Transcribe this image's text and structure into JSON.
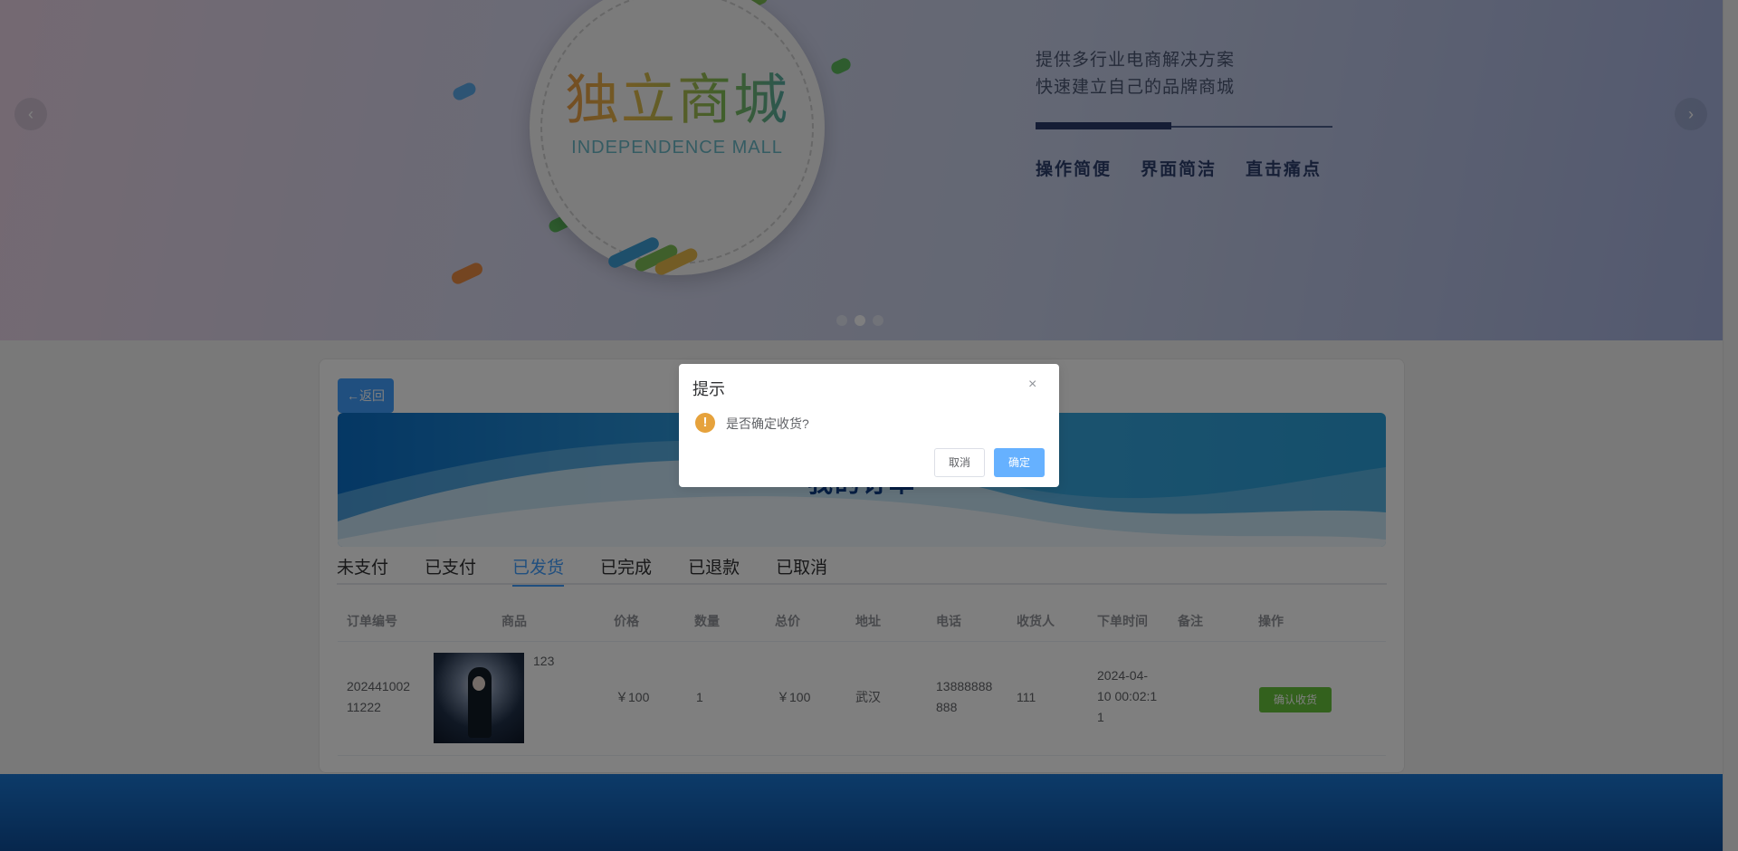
{
  "banner": {
    "logo_title": "独立商城",
    "logo_subtitle": "INDEPENDENCE MALL",
    "line1": "提供多行业电商解决方案",
    "line2": "快速建立自己的品牌商城",
    "features": [
      "操作简便",
      "界面简洁",
      "直击痛点"
    ],
    "carousel_active_index": 1,
    "carousel_count": 3
  },
  "back_label": "←返回",
  "header_title": "我的订单",
  "tabs": [
    "未支付",
    "已支付",
    "已发货",
    "已完成",
    "已退款",
    "已取消"
  ],
  "active_tab": "已发货",
  "table": {
    "headers": [
      "订单编号",
      "商品",
      "价格",
      "数量",
      "总价",
      "地址",
      "电话",
      "收货人",
      "下单时间",
      "备注",
      "操作"
    ],
    "rows": [
      {
        "order_no_line1": "202441002",
        "order_no_line2": "11222",
        "goods_name": "123",
        "price": "￥100",
        "quantity": "1",
        "total": "￥100",
        "address": "武汉",
        "phone_line1": "13888888",
        "phone_line2": "888",
        "receiver": "111",
        "time_line1": "2024-04-",
        "time_line2": "10 00:02:1",
        "time_line3": "1",
        "remark": "",
        "action": "确认收货"
      }
    ]
  },
  "dialog": {
    "title": "提示",
    "close": "×",
    "message": "是否确定收货?",
    "cancel": "取消",
    "ok": "确定"
  },
  "colors": {
    "primary": "#409eff",
    "success": "#67c23a",
    "warning": "#e6a23c"
  }
}
